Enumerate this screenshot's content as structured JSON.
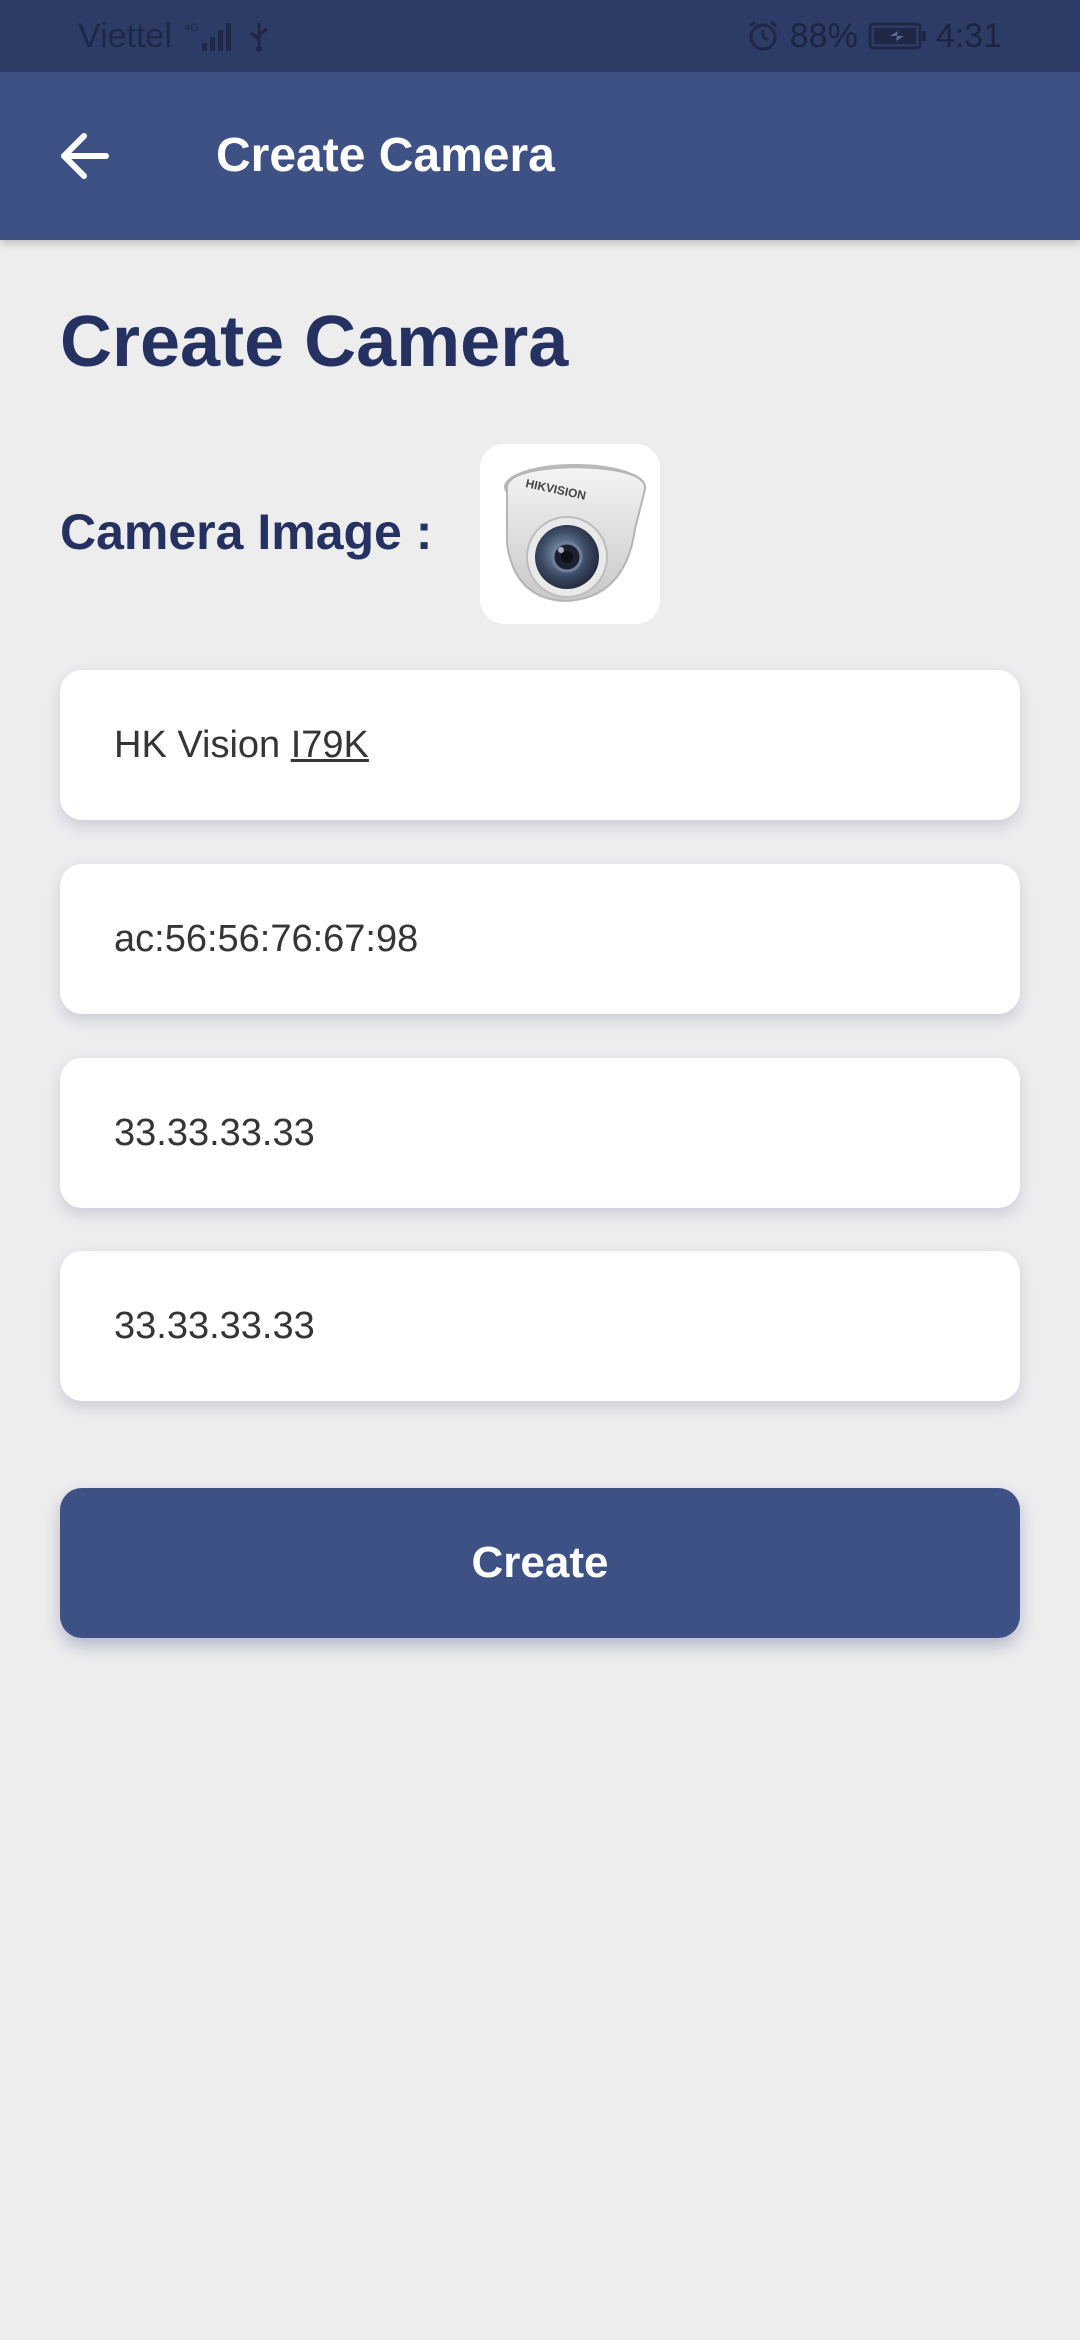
{
  "status_bar": {
    "carrier": "Viettel",
    "network": "4G",
    "battery": "88%",
    "time": "4:31",
    "icons": [
      "signal-icon",
      "usb-icon",
      "alarm-icon",
      "battery-icon"
    ]
  },
  "app_bar": {
    "title": "Create Camera",
    "back_icon": "arrow-left-icon"
  },
  "form": {
    "heading": "Create Camera",
    "image_label": "Camera Image :",
    "image_icon": "dome-camera-image",
    "fields": {
      "name_prefix": "HK Vision ",
      "name_suffix": "I79K",
      "mac": "ac:56:56:76:67:98",
      "ip_1": "33.33.33.33",
      "ip_2": "33.33.33.33"
    },
    "submit_label": "Create"
  },
  "colors": {
    "primary": "#3d5185",
    "status_bar": "#2d3c66",
    "heading": "#243161",
    "background": "#ededee"
  }
}
